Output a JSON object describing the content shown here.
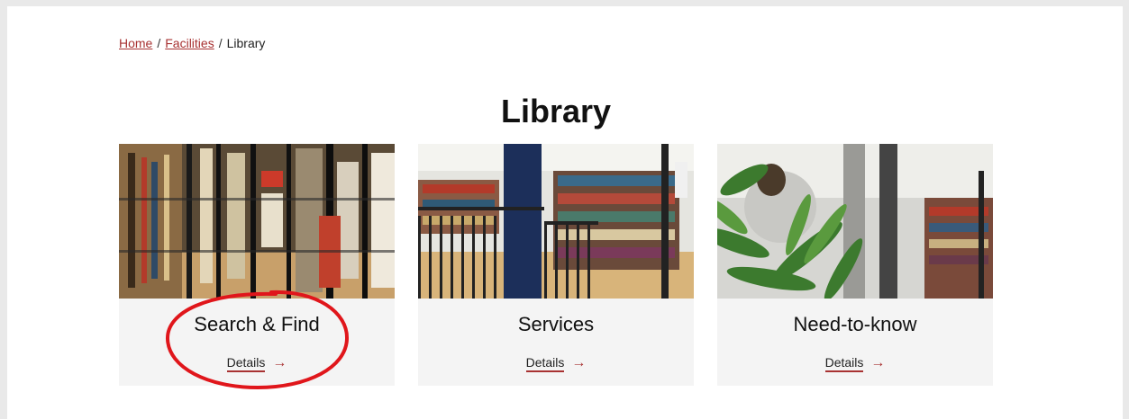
{
  "breadcrumb": {
    "home": "Home",
    "separator": "/",
    "facilities": "Facilities",
    "current": "Library"
  },
  "page": {
    "title": "Library"
  },
  "cards": [
    {
      "title": "Search & Find",
      "link": "Details",
      "arrow": "→"
    },
    {
      "title": "Services",
      "link": "Details",
      "arrow": "→"
    },
    {
      "title": "Need-to-know",
      "link": "Details",
      "arrow": "→"
    }
  ],
  "colors": {
    "accent": "#a83232",
    "annotation": "#e0161b",
    "card_bg": "#f4f4f4"
  }
}
